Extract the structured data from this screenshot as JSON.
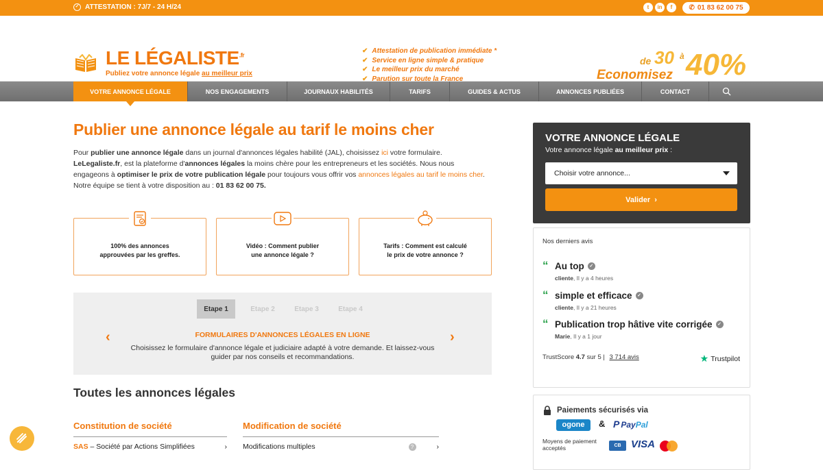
{
  "topbar": {
    "attestation": "ATTESTATION : 7J/7 - 24 H/24",
    "social": [
      "twitter-icon",
      "linkedin-icon",
      "facebook-icon"
    ],
    "phone": "01 83 62 00 75"
  },
  "logo": {
    "title": "LE LÉGALISTE",
    "tld": ".fr",
    "subtitle_pre": "Publiez votre annonce légale ",
    "subtitle_link": "au meilleur prix"
  },
  "features": [
    "Attestation de publication immédiate *",
    "Service en ligne simple & pratique",
    "Le meilleur prix du marché",
    "Parution sur toute la France"
  ],
  "promo": {
    "de": "de",
    "from": "30",
    "a": "à",
    "to": "40%",
    "label": "Economisez"
  },
  "nav": {
    "items": [
      "VOTRE ANNONCE LÉGALE",
      "NOS ENGAGEMENTS",
      "JOURNAUX HABILITÉS",
      "TARIFS",
      "GUIDES & ACTUS",
      "ANNONCES PUBLIÉES",
      "CONTACT"
    ]
  },
  "main": {
    "title": "Publier une annonce légale au tarif le moins cher",
    "intro": {
      "p1": "Pour ",
      "b1": "publier une annonce légale",
      "p2": " dans un journal d'annonces légales habilité (JAL), choisissez ",
      "link1": "ici",
      "p3": " votre formulaire. ",
      "b2": "LeLegaliste.fr",
      "p4": ", est la plateforme d'",
      "b3": "annonces légales",
      "p5": " la moins chère pour les entrepreneurs et les sociétés. Nous nous engageons à ",
      "b4": "optimiser le prix de votre publication légale",
      "p6": " pour toujours vous offrir vos ",
      "link2": "annonces légales au tarif le moins cher",
      "p7": ". Notre équipe se tient à votre disposition au : ",
      "b5": "01 83 62 00 75."
    },
    "cards": [
      {
        "line1": "100% des annonces",
        "line2": "approuvées par les greffes."
      },
      {
        "line1": "Vidéo : Comment publier",
        "line2": "une annonce légale ?"
      },
      {
        "line1": "Tarifs : Comment est calculé",
        "line2": "le prix de votre annonce ?"
      }
    ],
    "steps": {
      "tabs": [
        "Etape 1",
        "Etape 2",
        "Etape 3",
        "Etape 4"
      ],
      "title": "FORMULAIRES D'ANNONCES LÉGALES EN LIGNE",
      "text": "Choisissez le formulaire d'annonce légale et judiciaire adapté à votre demande. Et laissez-vous guider par nos conseils et recommandations."
    },
    "all_title": "Toutes les annonces légales",
    "categories": [
      {
        "title": "Constitution de société",
        "item_bold": "SAS",
        "item_rest": " – Société par Actions Simplifiées"
      },
      {
        "title": "Modification de société",
        "item_bold": "",
        "item_rest": "Modifications multiples"
      }
    ]
  },
  "sidebar": {
    "box_title": "VOTRE ANNONCE LÉGALE",
    "box_sub_pre": "Votre annonce légale ",
    "box_sub_bold": "au meilleur prix",
    "box_sub_post": " :",
    "select_value": "Choisir votre annonce...",
    "button": "Valider",
    "avis_header": "Nos derniers avis",
    "reviews": [
      {
        "title": "Au top",
        "author": "cliente",
        "time": "Il y a 4 heures"
      },
      {
        "title": "simple et efficace",
        "author": "cliente",
        "time": "Il y a 21 heures"
      },
      {
        "title": "Publication trop hâtive vite corrigée",
        "author": "Marie",
        "time": "Il y a 1 jour"
      }
    ],
    "trustscore_label": "TrustScore",
    "trustscore_value": "4.7",
    "trustscore_of": "sur 5",
    "avis_count": "3 714 avis",
    "trustpilot": "Trustpilot",
    "pay_title": "Paiements sécurisés via",
    "ogone": "ogone",
    "amp": "&",
    "paypal1": "Pay",
    "paypal2": "Pal",
    "pay_means": "Moyens de paiement acceptés",
    "cb": "CB",
    "visa": "VISA"
  },
  "colors": {
    "accent": "#f39111",
    "brand": "#f0780f",
    "dark": "#3a3a3a",
    "trust": "#00b67a"
  }
}
